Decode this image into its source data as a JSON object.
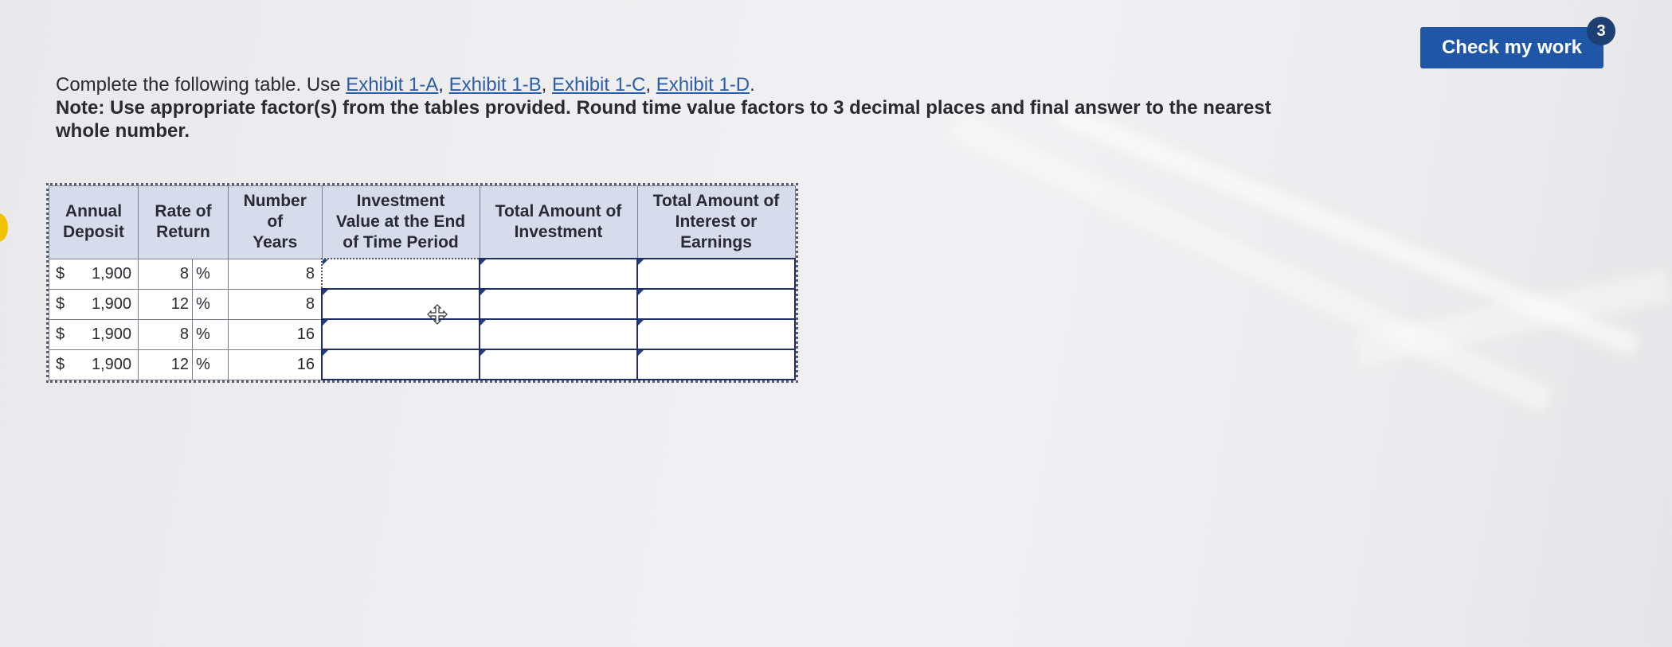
{
  "header": {
    "check_label": "Check my work",
    "badge_count": "3"
  },
  "instructions": {
    "intro": "Complete the following table. Use ",
    "exhibits": [
      "Exhibit 1-A",
      "Exhibit 1-B",
      "Exhibit 1-C",
      "Exhibit 1-D"
    ],
    "separator": ", ",
    "end": ".",
    "note": "Note: Use appropriate factor(s) from the tables provided. Round time value factors to 3 decimal places and final answer to the nearest whole number."
  },
  "table": {
    "headers": {
      "deposit_1": "Annual",
      "deposit_2": "Deposit",
      "rate_1": "Rate of",
      "rate_2": "Return",
      "years_1": "Number of",
      "years_2": "Years",
      "value_1": "Investment",
      "value_2": "Value at the End",
      "value_3": "of Time Period",
      "invest_1": "Total Amount of",
      "invest_2": "Investment",
      "interest_1": "Total Amount of",
      "interest_2": "Interest or",
      "interest_3": "Earnings"
    },
    "rows": [
      {
        "currency": "$",
        "deposit": "1,900",
        "rate": "8",
        "pct": "%",
        "years": "8",
        "value": "",
        "investment": "",
        "interest": ""
      },
      {
        "currency": "$",
        "deposit": "1,900",
        "rate": "12",
        "pct": "%",
        "years": "8",
        "value": "",
        "investment": "",
        "interest": ""
      },
      {
        "currency": "$",
        "deposit": "1,900",
        "rate": "8",
        "pct": "%",
        "years": "16",
        "value": "",
        "investment": "",
        "interest": ""
      },
      {
        "currency": "$",
        "deposit": "1,900",
        "rate": "12",
        "pct": "%",
        "years": "16",
        "value": "",
        "investment": "",
        "interest": ""
      }
    ]
  },
  "icons": {
    "cursor": "move-cursor-icon"
  }
}
